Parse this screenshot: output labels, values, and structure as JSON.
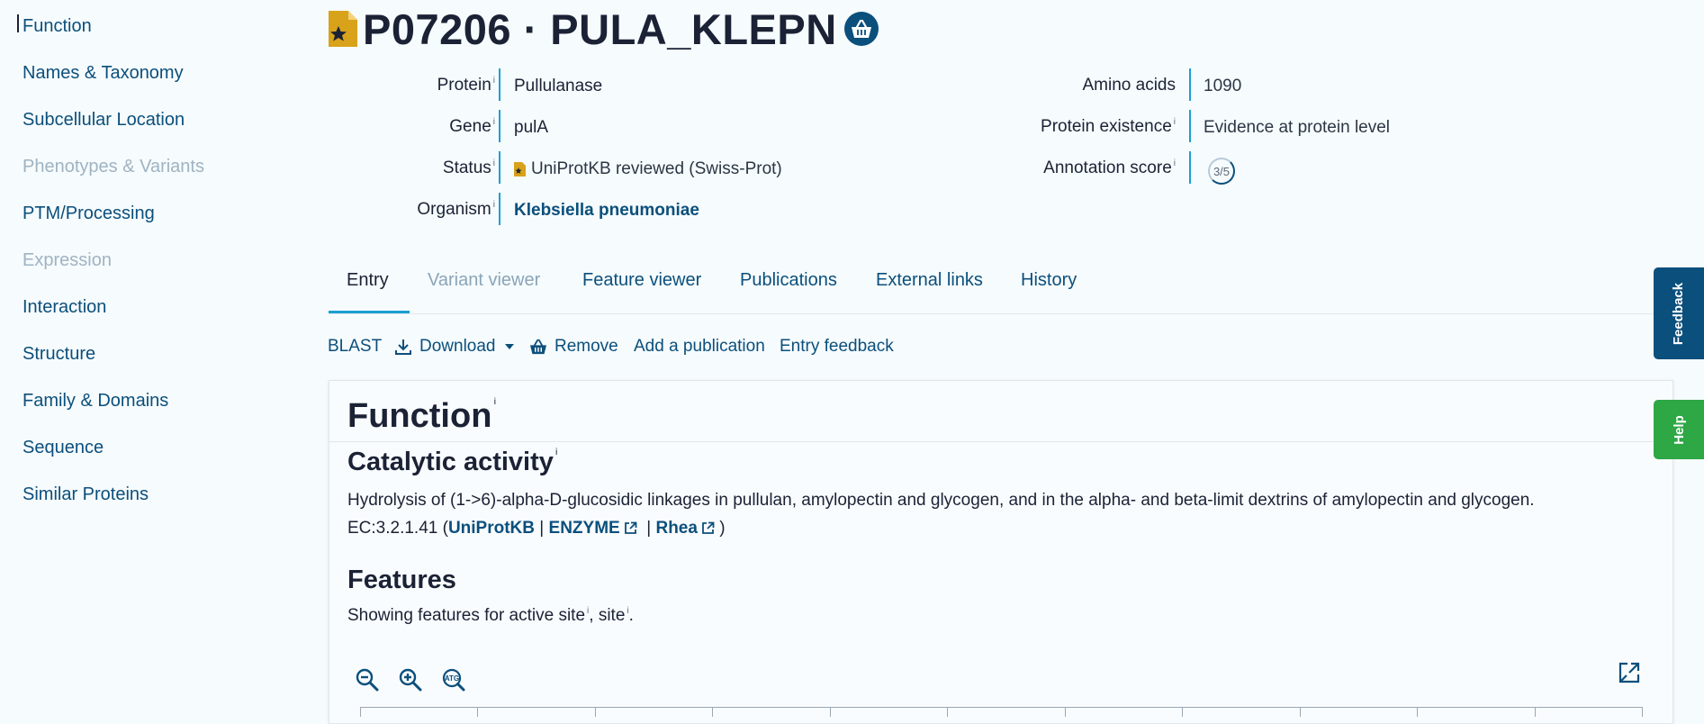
{
  "sidebar": {
    "items": [
      {
        "label": "Function",
        "state": "active"
      },
      {
        "label": "Names & Taxonomy",
        "state": "enabled"
      },
      {
        "label": "Subcellular Location",
        "state": "enabled"
      },
      {
        "label": "Phenotypes & Variants",
        "state": "disabled"
      },
      {
        "label": "PTM/Processing",
        "state": "enabled"
      },
      {
        "label": "Expression",
        "state": "disabled"
      },
      {
        "label": "Interaction",
        "state": "enabled"
      },
      {
        "label": "Structure",
        "state": "enabled"
      },
      {
        "label": "Family & Domains",
        "state": "enabled"
      },
      {
        "label": "Sequence",
        "state": "enabled"
      },
      {
        "label": "Similar Proteins",
        "state": "enabled"
      }
    ]
  },
  "header": {
    "title": "P07206 · PULA_KLEPN"
  },
  "info": {
    "protein": {
      "label": "Protein",
      "value": "Pullulanase"
    },
    "gene": {
      "label": "Gene",
      "value": "pulA"
    },
    "status": {
      "label": "Status",
      "value": "UniProtKB reviewed (Swiss-Prot)"
    },
    "organism": {
      "label": "Organism",
      "value": "Klebsiella pneumoniae"
    },
    "amino_acids": {
      "label": "Amino acids",
      "value": "1090"
    },
    "protein_existence": {
      "label": "Protein existence",
      "value": "Evidence at protein level"
    },
    "annotation_score": {
      "label": "Annotation score",
      "value": "3/5"
    },
    "info_marker": "i"
  },
  "tabs": [
    {
      "label": "Entry",
      "state": "active"
    },
    {
      "label": "Variant viewer",
      "state": "disabled"
    },
    {
      "label": "Feature viewer",
      "state": "enabled"
    },
    {
      "label": "Publications",
      "state": "enabled"
    },
    {
      "label": "External links",
      "state": "enabled"
    },
    {
      "label": "History",
      "state": "enabled"
    }
  ],
  "toolbar": {
    "blast": "BLAST",
    "download": "Download",
    "remove": "Remove",
    "add_publication": "Add a publication",
    "entry_feedback": "Entry feedback"
  },
  "function_section": {
    "title": "Function",
    "catalytic_title": "Catalytic activity",
    "catalytic_text": "Hydrolysis of (1->6)-alpha-D-glucosidic linkages in pullulan, amylopectin and glycogen, and in the alpha- and beta-limit dextrins of amylopectin and glycogen.",
    "ec_prefix": "EC:3.2.1.41 (",
    "ec_uniprot": "UniProtKB",
    "ec_sep1": " | ",
    "ec_enzyme": "ENZYME",
    "ec_sep2": " | ",
    "ec_rhea": "Rhea",
    "ec_suffix": " )",
    "features_title": "Features",
    "features_text_1": "Showing features for active site",
    "features_text_2": ", site",
    "features_text_3": "."
  },
  "floating": {
    "feedback": "Feedback",
    "help": "Help"
  },
  "colors": {
    "link": "#0b4f7c",
    "accent": "#1a9fd3",
    "feedback_bg": "#0b4f7c",
    "help_bg": "#2ea745",
    "reviewed_icon": "#d9a21b"
  },
  "icons": [
    "reviewed-document-icon",
    "basket-icon",
    "download-icon",
    "caret-down-icon",
    "external-link-icon",
    "zoom-out-icon",
    "zoom-in-icon",
    "sequence-atg-icon",
    "fullscreen-icon"
  ]
}
